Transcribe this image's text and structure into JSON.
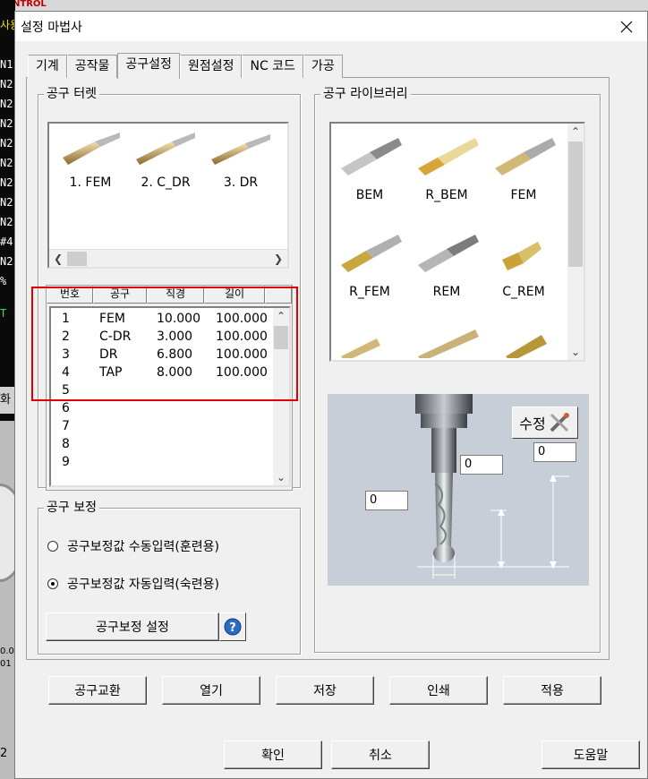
{
  "background_app": {
    "brand": "SENTROL",
    "side_lines": [
      "사용",
      "N1",
      "N2",
      "N2",
      "N2",
      "N2",
      "N2",
      "N2",
      "N2",
      "N2",
      "#4",
      "N2",
      "%"
    ],
    "green_text": "T",
    "side_label": "화",
    "small_values": [
      "0.0",
      "01",
      "2"
    ]
  },
  "dialog": {
    "title": "설정 마법사",
    "close_icon": "close-icon"
  },
  "tabs": [
    {
      "label": "기계",
      "active": false
    },
    {
      "label": "공작물",
      "active": false
    },
    {
      "label": "공구설정",
      "active": true
    },
    {
      "label": "원점설정",
      "active": false
    },
    {
      "label": "NC 코드",
      "active": false
    },
    {
      "label": "가공",
      "active": false
    }
  ],
  "turret": {
    "title": "공구 터렛",
    "tools": [
      "1. FEM",
      "2. C_DR",
      "3. DR"
    ],
    "table_headers": [
      "번호",
      "공구",
      "직경",
      "길이"
    ],
    "rows": [
      {
        "no": "1",
        "tool": "FEM",
        "diameter": "10.000",
        "length": "100.000"
      },
      {
        "no": "2",
        "tool": "C-DR",
        "diameter": "3.000",
        "length": "100.000"
      },
      {
        "no": "3",
        "tool": "DR",
        "diameter": "6.800",
        "length": "100.000"
      },
      {
        "no": "4",
        "tool": "TAP",
        "diameter": "8.000",
        "length": "100.000"
      },
      {
        "no": "5",
        "tool": "",
        "diameter": "",
        "length": ""
      },
      {
        "no": "6",
        "tool": "",
        "diameter": "",
        "length": ""
      },
      {
        "no": "7",
        "tool": "",
        "diameter": "",
        "length": ""
      },
      {
        "no": "8",
        "tool": "",
        "diameter": "",
        "length": ""
      },
      {
        "no": "9",
        "tool": "",
        "diameter": "",
        "length": ""
      }
    ]
  },
  "compensation": {
    "title": "공구 보정",
    "option_manual": "공구보정값 수동입력(훈련용)",
    "option_auto": "공구보정값 자동입력(숙련용)",
    "selected": "auto",
    "settings_button": "공구보정 설정",
    "help_icon": "help-icon"
  },
  "library": {
    "title": "공구 라이브러리",
    "tools": [
      "BEM",
      "R_BEM",
      "FEM",
      "R_FEM",
      "REM",
      "C_REM"
    ]
  },
  "diagram": {
    "edit_button": "수정",
    "edit_icon": "tools-icon",
    "inputs": [
      "0",
      "0",
      "0"
    ]
  },
  "bottom_buttons": [
    "공구교환",
    "열기",
    "저장",
    "인쇄",
    "적용"
  ],
  "footer_buttons": {
    "ok": "확인",
    "cancel": "취소",
    "help": "도움말"
  }
}
